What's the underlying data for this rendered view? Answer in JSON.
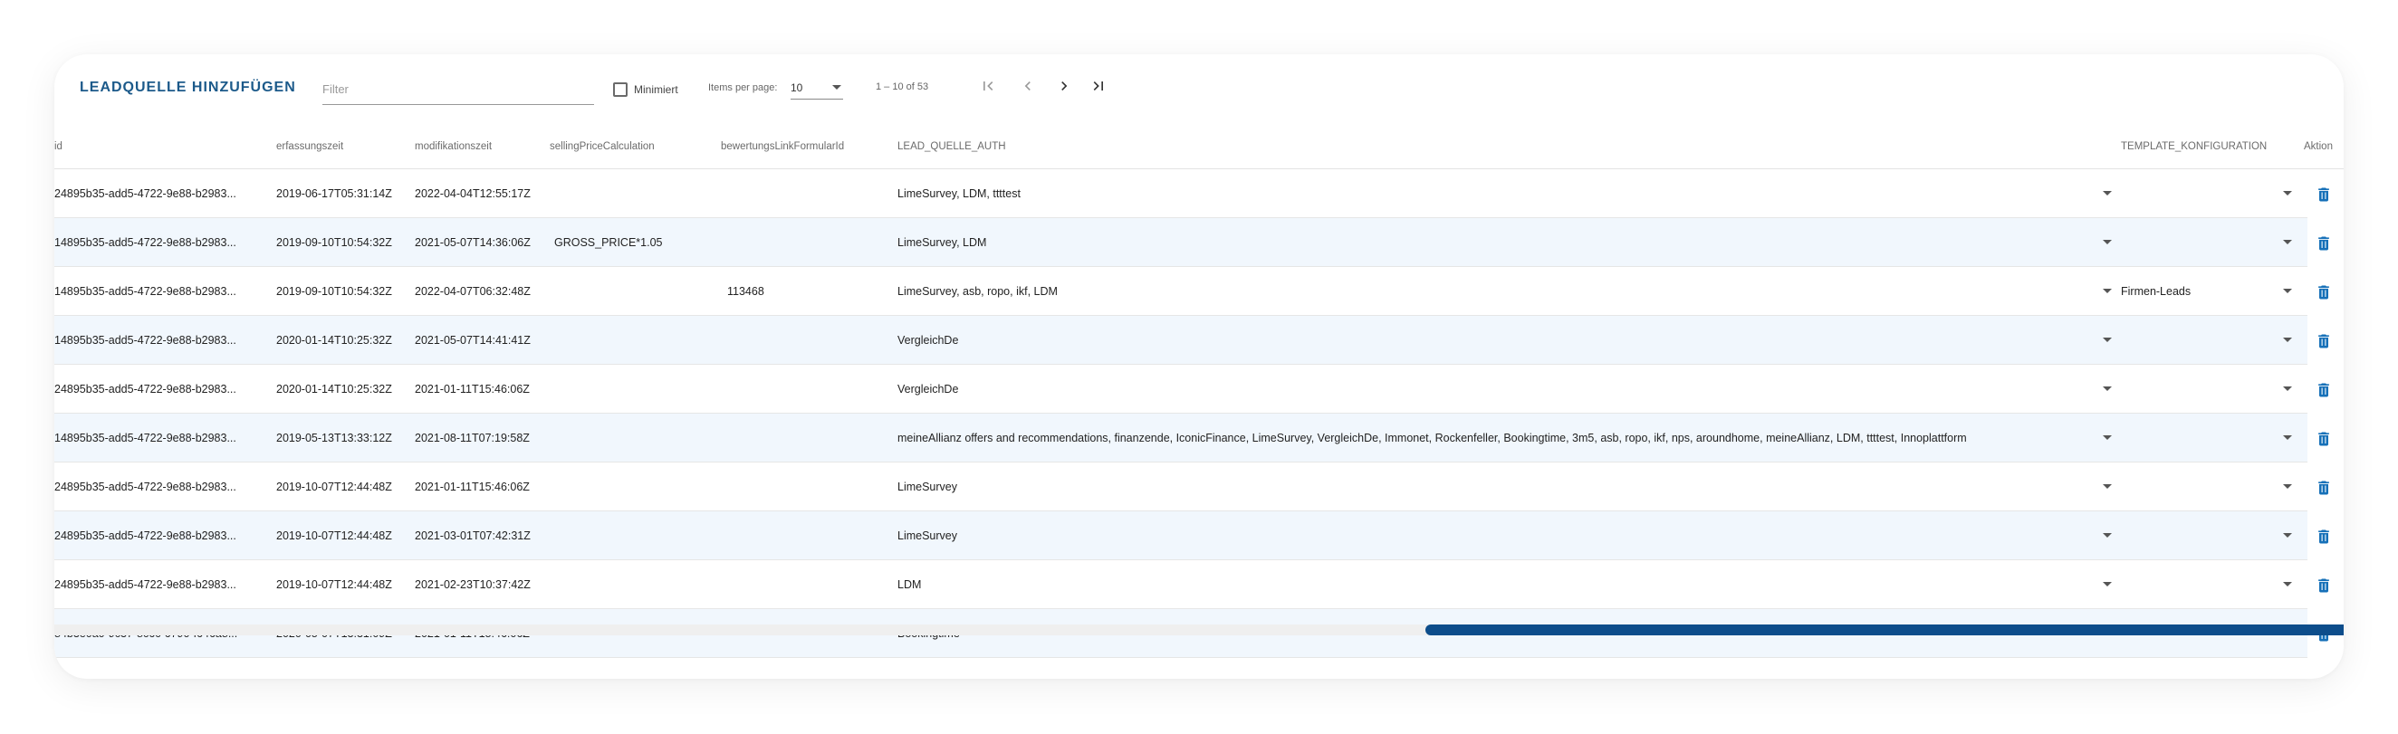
{
  "toolbar": {
    "title": "LEADQUELLE HINZUFÜGEN",
    "filter_placeholder": "Filter",
    "filter_value": "",
    "minimized_label": "Minimiert",
    "minimized_checked": false,
    "items_per_page_label": "Items per page:",
    "items_per_page_value": "10",
    "range_label": "1 – 10 of 53",
    "icons": {
      "first": "first-page-icon",
      "prev": "chevron-left-icon",
      "next": "chevron-right-icon",
      "last": "last-page-icon"
    }
  },
  "colors": {
    "accent": "#1c5a8a",
    "scroll_thumb": "#0d4d8b",
    "row_alt": "#f1f7fd",
    "trash": "#1670b8"
  },
  "columns": {
    "id": "id",
    "erfassungszeit": "erfassungszeit",
    "modifikationszeit": "modifikationszeit",
    "selling": "sellingPriceCalculation",
    "bewertung": "bewertungsLinkFormularId",
    "auth": "LEAD_QUELLE_AUTH",
    "template": "TEMPLATE_KONFIGURATION",
    "aktion": "Aktion"
  },
  "rows": [
    {
      "id": "24895b35-add5-4722-9e88-b2983...",
      "erfassungszeit": "2019-06-17T05:31:14Z",
      "modifikationszeit": "2022-04-04T12:55:17Z",
      "selling": "",
      "bewertung": "",
      "auth": "LimeSurvey, LDM, ttttest",
      "template": ""
    },
    {
      "id": "14895b35-add5-4722-9e88-b2983...",
      "erfassungszeit": "2019-09-10T10:54:32Z",
      "modifikationszeit": "2021-05-07T14:36:06Z",
      "selling": "GROSS_PRICE*1.05",
      "bewertung": "",
      "auth": "LimeSurvey, LDM",
      "template": ""
    },
    {
      "id": "14895b35-add5-4722-9e88-b2983...",
      "erfassungszeit": "2019-09-10T10:54:32Z",
      "modifikationszeit": "2022-04-07T06:32:48Z",
      "selling": "",
      "bewertung": "113468",
      "auth": "LimeSurvey, asb, ropo, ikf, LDM",
      "template": "Firmen-Leads"
    },
    {
      "id": "14895b35-add5-4722-9e88-b2983...",
      "erfassungszeit": "2020-01-14T10:25:32Z",
      "modifikationszeit": "2021-05-07T14:41:41Z",
      "selling": "",
      "bewertung": "",
      "auth": "VergleichDe",
      "template": ""
    },
    {
      "id": "24895b35-add5-4722-9e88-b2983...",
      "erfassungszeit": "2020-01-14T10:25:32Z",
      "modifikationszeit": "2021-01-11T15:46:06Z",
      "selling": "",
      "bewertung": "",
      "auth": "VergleichDe",
      "template": ""
    },
    {
      "id": "14895b35-add5-4722-9e88-b2983...",
      "erfassungszeit": "2019-05-13T13:33:12Z",
      "modifikationszeit": "2021-08-11T07:19:58Z",
      "selling": "",
      "bewertung": "",
      "auth": "meineAllianz offers and recommendations, finanzende, IconicFinance, LimeSurvey, VergleichDe, Immonet, Rockenfeller, Bookingtime, 3m5, asb, ropo, ikf, nps, aroundhome, meineAllianz, LDM, ttttest, Innoplattform",
      "template": ""
    },
    {
      "id": "24895b35-add5-4722-9e88-b2983...",
      "erfassungszeit": "2019-10-07T12:44:48Z",
      "modifikationszeit": "2021-01-11T15:46:06Z",
      "selling": "",
      "bewertung": "",
      "auth": "LimeSurvey",
      "template": ""
    },
    {
      "id": "24895b35-add5-4722-9e88-b2983...",
      "erfassungszeit": "2019-10-07T12:44:48Z",
      "modifikationszeit": "2021-03-01T07:42:31Z",
      "selling": "",
      "bewertung": "",
      "auth": "LimeSurvey",
      "template": ""
    },
    {
      "id": "24895b35-add5-4722-9e88-b2983...",
      "erfassungszeit": "2019-10-07T12:44:48Z",
      "modifikationszeit": "2021-02-23T10:37:42Z",
      "selling": "",
      "bewertung": "",
      "auth": "LDM",
      "template": ""
    },
    {
      "id": "84b3e0a0-9c37-8c6c-6790-f646a8...",
      "erfassungszeit": "2020-05-07T13:31:09Z",
      "modifikationszeit": "2021-01-11T15:46:06Z",
      "selling": "",
      "bewertung": "",
      "auth": "Bookingtime",
      "template": ""
    }
  ]
}
